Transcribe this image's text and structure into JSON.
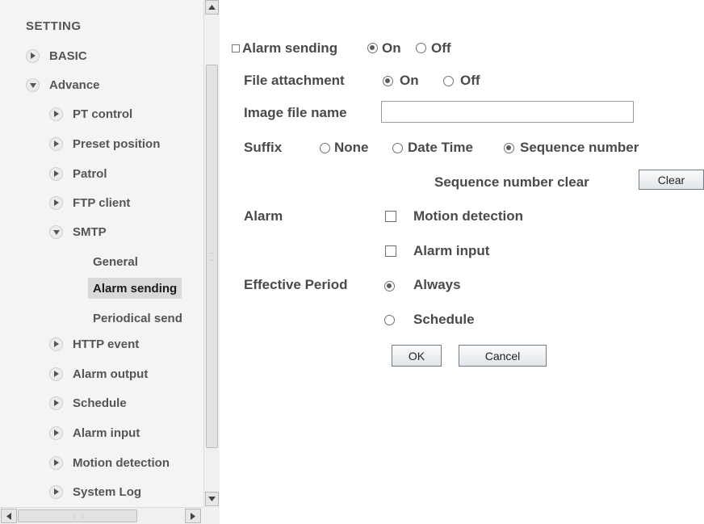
{
  "nav": {
    "title": "SETTING",
    "items": [
      {
        "label": "BASIC"
      },
      {
        "label": "Advance"
      },
      {
        "label": "PT control"
      },
      {
        "label": "Preset position"
      },
      {
        "label": "Patrol"
      },
      {
        "label": "FTP client"
      },
      {
        "label": "SMTP"
      },
      {
        "label": "General"
      },
      {
        "label": "Alarm sending"
      },
      {
        "label": "Periodical send"
      },
      {
        "label": "HTTP event"
      },
      {
        "label": "Alarm output"
      },
      {
        "label": "Schedule"
      },
      {
        "label": "Alarm input"
      },
      {
        "label": "Motion detection"
      },
      {
        "label": "System Log"
      }
    ],
    "active_item": "Alarm sending"
  },
  "form": {
    "alarm_sending": {
      "label": "Alarm sending",
      "on_label": "On",
      "off_label": "Off",
      "value": "On"
    },
    "file_attachment": {
      "label": "File attachment",
      "on_label": "On",
      "off_label": "Off",
      "value": "On"
    },
    "image_file_name": {
      "label": "Image file name",
      "value": ""
    },
    "suffix": {
      "label": "Suffix",
      "options": [
        "None",
        "Date Time",
        "Sequence number"
      ],
      "value": "Sequence number"
    },
    "sequence_clear": {
      "label": "Sequence number clear",
      "button": "Clear"
    },
    "alarm": {
      "label": "Alarm",
      "motion_detection": "Motion detection",
      "alarm_input": "Alarm input",
      "motion_detection_checked": false,
      "alarm_input_checked": false
    },
    "effective_period": {
      "label": "Effective Period",
      "always": "Always",
      "schedule": "Schedule",
      "value": "Always"
    },
    "ok_button": "OK",
    "cancel_button": "Cancel"
  }
}
